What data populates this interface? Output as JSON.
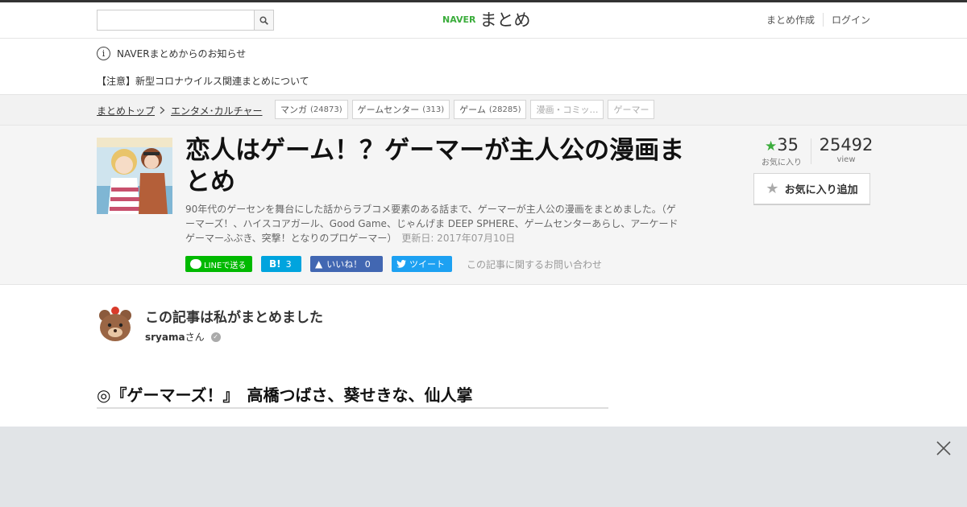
{
  "topbar": {
    "search_placeholder": "",
    "logo_naver": "NAVER",
    "logo_matome": "まとめ",
    "links": [
      "まとめ作成",
      "ログイン"
    ]
  },
  "notice": {
    "heading": "NAVERまとめからのお知らせ",
    "item": "【注意】新型コロナウイルス関連まとめについて"
  },
  "breadcrumb": {
    "items": [
      "まとめトップ",
      "エンタメ･カルチャー"
    ],
    "tags": [
      {
        "label": "マンガ",
        "count": "(24873)"
      },
      {
        "label": "ゲームセンター",
        "count": "(313)"
      },
      {
        "label": "ゲーム",
        "count": "(28285)"
      },
      {
        "label": "漫画・コミッ…",
        "count": ""
      },
      {
        "label": "ゲーマー",
        "count": ""
      }
    ]
  },
  "article": {
    "title": "恋人はゲーム！？ゲーマーが主人公の漫画まとめ",
    "description": "90年代のゲーセンを舞台にした話からラブコメ要素のある話まで、ゲーマーが主人公の漫画をまとめました。（ゲーマーズ！、ハイスコアガール、Good Game、じゃんげま DEEP SPHERE、ゲームセンターあらし、アーケードゲーマーふぶき、突撃！となりのプロゲーマー）",
    "updated": "更新日: 2017年07月10日",
    "favorites": "35",
    "favorites_label": "お気に入り",
    "views": "25492",
    "views_label": "view",
    "fav_button": "お気に入り追加"
  },
  "social": {
    "line": "LINEで送る",
    "hatena_count": "3",
    "facebook": "いいね！ 0",
    "twitter": "ツイート",
    "contact": "この記事に関するお問い合わせ"
  },
  "author": {
    "title": "この記事は私がまとめました",
    "name": "sryama",
    "suffix": "さん"
  },
  "section": {
    "heading": "◎『ゲーマーズ！』　高橋つばさ、葵せきな、仙人掌"
  },
  "colors": {
    "naver_green": "#3bad3c",
    "line_green": "#00b900",
    "hatena_blue": "#00a4de",
    "facebook_blue": "#4267b2",
    "twitter_blue": "#1da1f2"
  },
  "icons": [
    "search-icon",
    "info-icon",
    "chevron-right-icon",
    "star-icon",
    "verified-icon",
    "close-icon"
  ]
}
